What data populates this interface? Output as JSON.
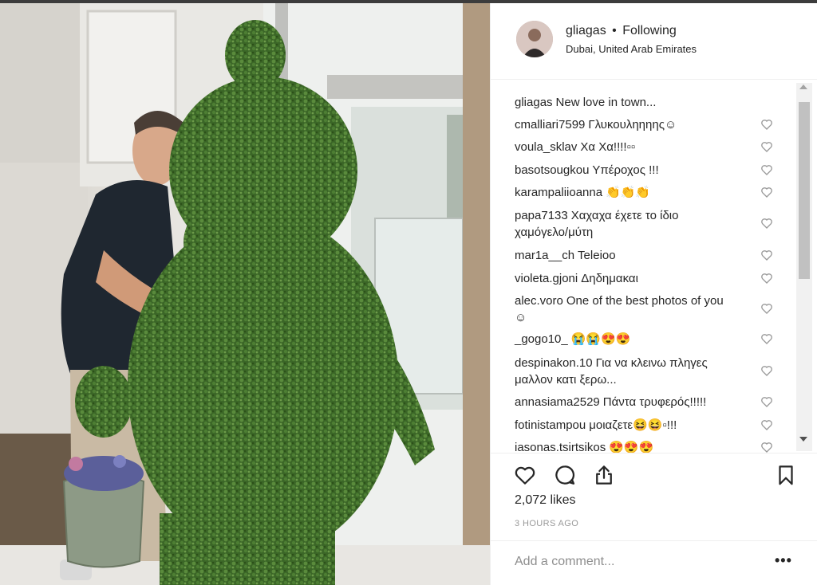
{
  "post": {
    "username": "gliagas",
    "separator": "•",
    "follow_status": "Following",
    "location": "Dubai, United Arab Emirates"
  },
  "comments": [
    {
      "user": "gliagas",
      "text": "New love in town...",
      "has_like": false
    },
    {
      "user": "cmalliari7599",
      "text": "Γλυκουληηηης☺",
      "has_like": true
    },
    {
      "user": "voula_sklav",
      "text": "Χα Χα!!!!▫▫",
      "has_like": true
    },
    {
      "user": "basotsougkou",
      "text": "Υπέροχος !!!",
      "has_like": true
    },
    {
      "user": "karampaliioanna",
      "text": "👏👏👏",
      "has_like": true
    },
    {
      "user": "papa7133",
      "text": "Χαχαχα έχετε το ίδιο χαμόγελο/μύτη",
      "has_like": true
    },
    {
      "user": "mar1a__ch",
      "text": "Teleioo",
      "has_like": true
    },
    {
      "user": "violeta.gjoni",
      "text": "Δηδημακαι",
      "has_like": true
    },
    {
      "user": "alec.voro",
      "text": "One of the best photos of you ☺",
      "has_like": true
    },
    {
      "user": "_gogo10_",
      "text": "😭😭😍😍",
      "has_like": true
    },
    {
      "user": "despinakon.10",
      "text": "Για να κλεινω πληγες μαλλον κατι ξερω...",
      "has_like": true
    },
    {
      "user": "annasiama2529",
      "text": "Πάντα τρυφερός!!!!!",
      "has_like": true
    },
    {
      "user": "fotinistampou",
      "text": "μοιαζετε😆😆▫!!!",
      "has_like": true
    },
    {
      "user": "iasonas.tsirtsikos",
      "text": "😍😍😍",
      "has_like": true
    }
  ],
  "actions": {
    "likes": "2,072 likes",
    "time": "3 HOURS AGO",
    "like_icon": "heart-icon",
    "comment_icon": "speech-bubble-icon",
    "share_icon": "share-icon",
    "save_icon": "bookmark-icon"
  },
  "add_comment": {
    "placeholder": "Add a comment...",
    "more_label": "•••"
  },
  "colors": {
    "text": "#262626",
    "muted": "#999999",
    "border": "#efefef",
    "foliage": "#3f6b2a"
  }
}
